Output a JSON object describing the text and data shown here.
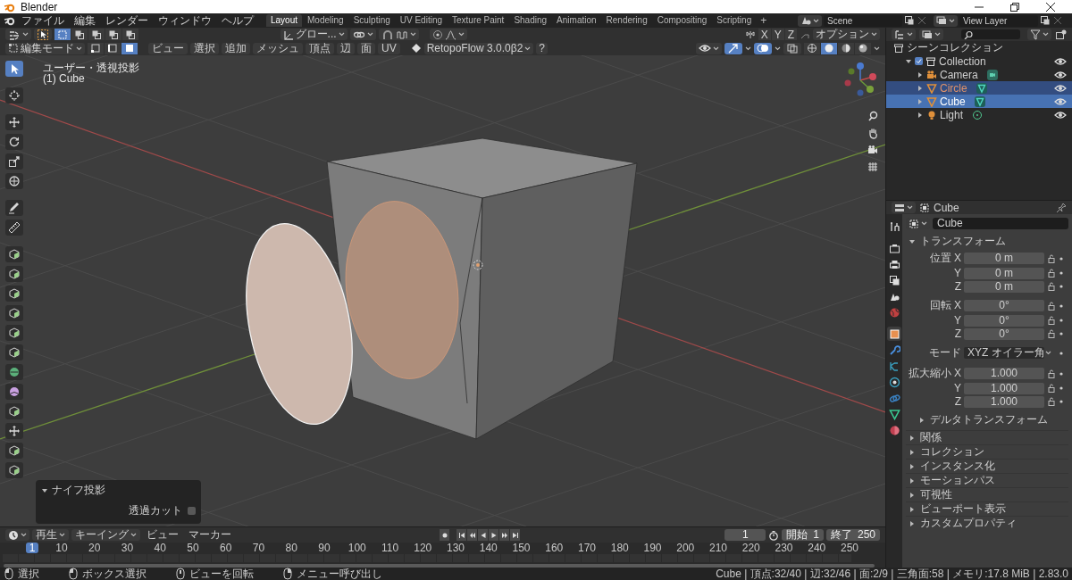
{
  "window": {
    "title": "Blender"
  },
  "menus": [
    "ファイル",
    "編集",
    "レンダー",
    "ウィンドウ",
    "ヘルプ"
  ],
  "workspaces": [
    {
      "label": "Layout",
      "selected": true
    },
    {
      "label": "Modeling",
      "selected": false
    },
    {
      "label": "Sculpting",
      "selected": false
    },
    {
      "label": "UV Editing",
      "selected": false
    },
    {
      "label": "Texture Paint",
      "selected": false
    },
    {
      "label": "Shading",
      "selected": false
    },
    {
      "label": "Animation",
      "selected": false
    },
    {
      "label": "Rendering",
      "selected": false
    },
    {
      "label": "Compositing",
      "selected": false
    },
    {
      "label": "Scripting",
      "selected": false
    }
  ],
  "add_workspace": "+",
  "scene": "Scene",
  "view_layer": "View Layer",
  "tool_header": {
    "select_box_modes": [
      {
        "selected": true
      },
      {
        "selected": false
      },
      {
        "selected": false
      },
      {
        "selected": false
      },
      {
        "selected": false
      }
    ],
    "orientation": "グロー...",
    "mirror_axes": [
      {
        "label": "X",
        "selected": false
      },
      {
        "label": "Y",
        "selected": false
      },
      {
        "label": "Z",
        "selected": false
      }
    ],
    "options": "オプション"
  },
  "view_header": {
    "mode": "編集モード",
    "select_modes": [
      {
        "kind": "vertex",
        "selected": false
      },
      {
        "kind": "edge",
        "selected": false
      },
      {
        "kind": "face",
        "selected": true
      }
    ],
    "menus": [
      "ビュー",
      "選択",
      "追加",
      "メッシュ",
      "頂点",
      "辺",
      "面",
      "UV"
    ],
    "addon": "RetopoFlow 3.0.0β2",
    "help": "?",
    "gizmos_on": true,
    "overlays_on": true,
    "xray_on": false,
    "shading": [
      {
        "kind": "wireframe",
        "selected": false
      },
      {
        "kind": "solid",
        "selected": true
      },
      {
        "kind": "material",
        "selected": false
      },
      {
        "kind": "rendered",
        "selected": false
      }
    ]
  },
  "viewport": {
    "view_name": "ユーザー・透視投影",
    "object_label": "(1) Cube",
    "tools": [
      {
        "kind": "select",
        "selected": true
      },
      {
        "kind": "cursor",
        "selected": false
      },
      {
        "kind": "move",
        "selected": false
      },
      {
        "kind": "rotate",
        "selected": false
      },
      {
        "kind": "scale",
        "selected": false
      },
      {
        "kind": "transform",
        "selected": false
      },
      {
        "kind": "annotate",
        "selected": false
      },
      {
        "kind": "measure",
        "selected": false
      },
      {
        "kind": "mesh",
        "selected": false
      },
      {
        "kind": "mesh",
        "selected": false
      },
      {
        "kind": "mesh",
        "selected": false
      },
      {
        "kind": "mesh",
        "selected": false
      },
      {
        "kind": "mesh",
        "selected": false
      },
      {
        "kind": "mesh",
        "selected": false
      },
      {
        "kind": "spin",
        "selected": false
      },
      {
        "kind": "smooth",
        "selected": false
      },
      {
        "kind": "mesh",
        "selected": false
      },
      {
        "kind": "move",
        "selected": false
      },
      {
        "kind": "mesh",
        "selected": false
      },
      {
        "kind": "mesh",
        "selected": false
      }
    ],
    "knife_panel": {
      "title": "ナイフ投影",
      "expanded": true,
      "option": "透過カット",
      "checked": false
    }
  },
  "outliner": {
    "root": "シーンコレクション",
    "items": [
      {
        "name": "Collection",
        "kind": "collection",
        "checked": true,
        "expanded": true,
        "selected": false,
        "active": false,
        "children": [
          {
            "name": "Camera",
            "kind": "camera",
            "expanded": false,
            "selected": false,
            "active": false
          },
          {
            "name": "Circle",
            "kind": "mesh",
            "expanded": false,
            "selected": true,
            "active": false
          },
          {
            "name": "Cube",
            "kind": "mesh",
            "expanded": false,
            "selected": true,
            "active": true
          },
          {
            "name": "Light",
            "kind": "light",
            "expanded": false,
            "selected": false,
            "active": false
          }
        ]
      }
    ]
  },
  "properties": {
    "context": "Cube",
    "object_name": "Cube",
    "tab_groups": [
      [
        {
          "kind": "tool",
          "selected": false
        }
      ],
      [
        {
          "kind": "render",
          "selected": false
        },
        {
          "kind": "output",
          "selected": false
        },
        {
          "kind": "view_layer",
          "selected": false
        },
        {
          "kind": "scene",
          "selected": false
        },
        {
          "kind": "world",
          "selected": false
        }
      ],
      [
        {
          "kind": "object",
          "selected": true
        },
        {
          "kind": "modifiers",
          "selected": false
        },
        {
          "kind": "particles",
          "selected": false
        },
        {
          "kind": "physics",
          "selected": false
        },
        {
          "kind": "constraints",
          "selected": false
        },
        {
          "kind": "data",
          "selected": false
        },
        {
          "kind": "material",
          "selected": false
        }
      ]
    ],
    "transform": {
      "title": "トランスフォーム",
      "expanded": true,
      "groups": [
        {
          "kind": "vector",
          "rows": [
            {
              "label": "位置 X",
              "value": "0 m"
            },
            {
              "label": "Y",
              "value": "0 m"
            },
            {
              "label": "Z",
              "value": "0 m"
            }
          ]
        },
        {
          "kind": "vector",
          "rows": [
            {
              "label": "回転 X",
              "value": "0°"
            },
            {
              "label": "Y",
              "value": "0°"
            },
            {
              "label": "Z",
              "value": "0°"
            }
          ]
        },
        {
          "kind": "dropdown",
          "label": "モード",
          "value": "XYZ オイラー角"
        },
        {
          "kind": "vector",
          "rows": [
            {
              "label": "拡大縮小 X",
              "value": "1.000"
            },
            {
              "label": "Y",
              "value": "1.000"
            },
            {
              "label": "Z",
              "value": "1.000"
            }
          ]
        }
      ],
      "subpanel": {
        "title": "デルタトランスフォーム",
        "expanded": false
      }
    },
    "panels": [
      {
        "title": "関係",
        "expanded": false
      },
      {
        "title": "コレクション",
        "expanded": false
      },
      {
        "title": "インスタンス化",
        "expanded": false
      },
      {
        "title": "モーションパス",
        "expanded": false
      },
      {
        "title": "可視性",
        "expanded": false
      },
      {
        "title": "ビューポート表示",
        "expanded": false
      },
      {
        "title": "カスタムプロパティ",
        "expanded": false
      }
    ]
  },
  "timeline": {
    "menus": [
      {
        "label": "再生",
        "dropdown": true
      },
      {
        "label": "キーイング",
        "dropdown": true
      },
      {
        "label": "ビュー",
        "dropdown": false
      },
      {
        "label": "マーカー",
        "dropdown": false
      }
    ],
    "current_frame": "1",
    "start": {
      "label": "開始",
      "value": "1"
    },
    "end": {
      "label": "終了",
      "value": "250"
    },
    "playhead": "1",
    "ruler": [
      "10",
      "20",
      "30",
      "40",
      "50",
      "60",
      "70",
      "80",
      "90",
      "100",
      "110",
      "120",
      "130",
      "140",
      "150",
      "160",
      "170",
      "180",
      "190",
      "200",
      "210",
      "220",
      "230",
      "240",
      "250"
    ]
  },
  "status_bar": {
    "hints": [
      "選択",
      "ボックス選択",
      "ビューを回転",
      "メニュー呼び出し"
    ],
    "stats": "Cube | 頂点:32/40 | 辺:32/46 | 面:2/9 | 三角面:58 | メモリ:17.8 MiB | 2.83.0"
  }
}
